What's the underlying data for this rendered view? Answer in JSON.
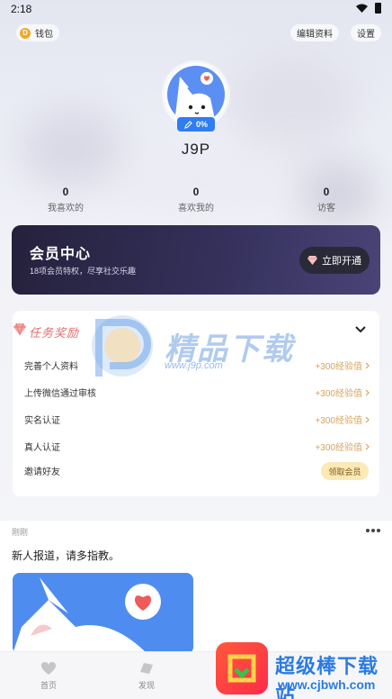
{
  "status_bar": {
    "time": "2:18"
  },
  "top_bar": {
    "wallet_label": "钱包",
    "coin_glyph": "D",
    "edit_profile_label": "编辑资料",
    "settings_label": "设置"
  },
  "profile": {
    "username": "J9P",
    "progress": "0%"
  },
  "stats": [
    {
      "value": "0",
      "label": "我喜欢的"
    },
    {
      "value": "0",
      "label": "喜欢我的"
    },
    {
      "value": "0",
      "label": "访客"
    }
  ],
  "member_card": {
    "title": "会员中心",
    "subtitle": "18项会员特权，尽享社交乐趣",
    "cta_label": "立即开通"
  },
  "tasks": {
    "title": "任务奖励",
    "items": [
      {
        "label": "完善个人资料",
        "reward": "+300经验值"
      },
      {
        "label": "上传微信通过审核",
        "reward": "+300经验值"
      },
      {
        "label": "实名认证",
        "reward": "+300经验值"
      },
      {
        "label": "真人认证",
        "reward": "+300经验值"
      },
      {
        "label": "邀请好友",
        "reward": "领取会员"
      }
    ]
  },
  "watermark": {
    "title": "精品下载",
    "url": "www.j9p.com"
  },
  "feed": {
    "time": "刚刚",
    "text": "新人报道，请多指教。"
  },
  "bottom_nav": {
    "home_label": "首页",
    "discover_label": "发现"
  },
  "corner_watermark": {
    "title": "超级棒下载站",
    "url": "www.cjbwh.com"
  },
  "colors": {
    "accent_blue": "#2f7df3",
    "reward_gold": "#d9a35a",
    "task_title_red": "#e46c6c",
    "member_dark": "#25213c"
  }
}
